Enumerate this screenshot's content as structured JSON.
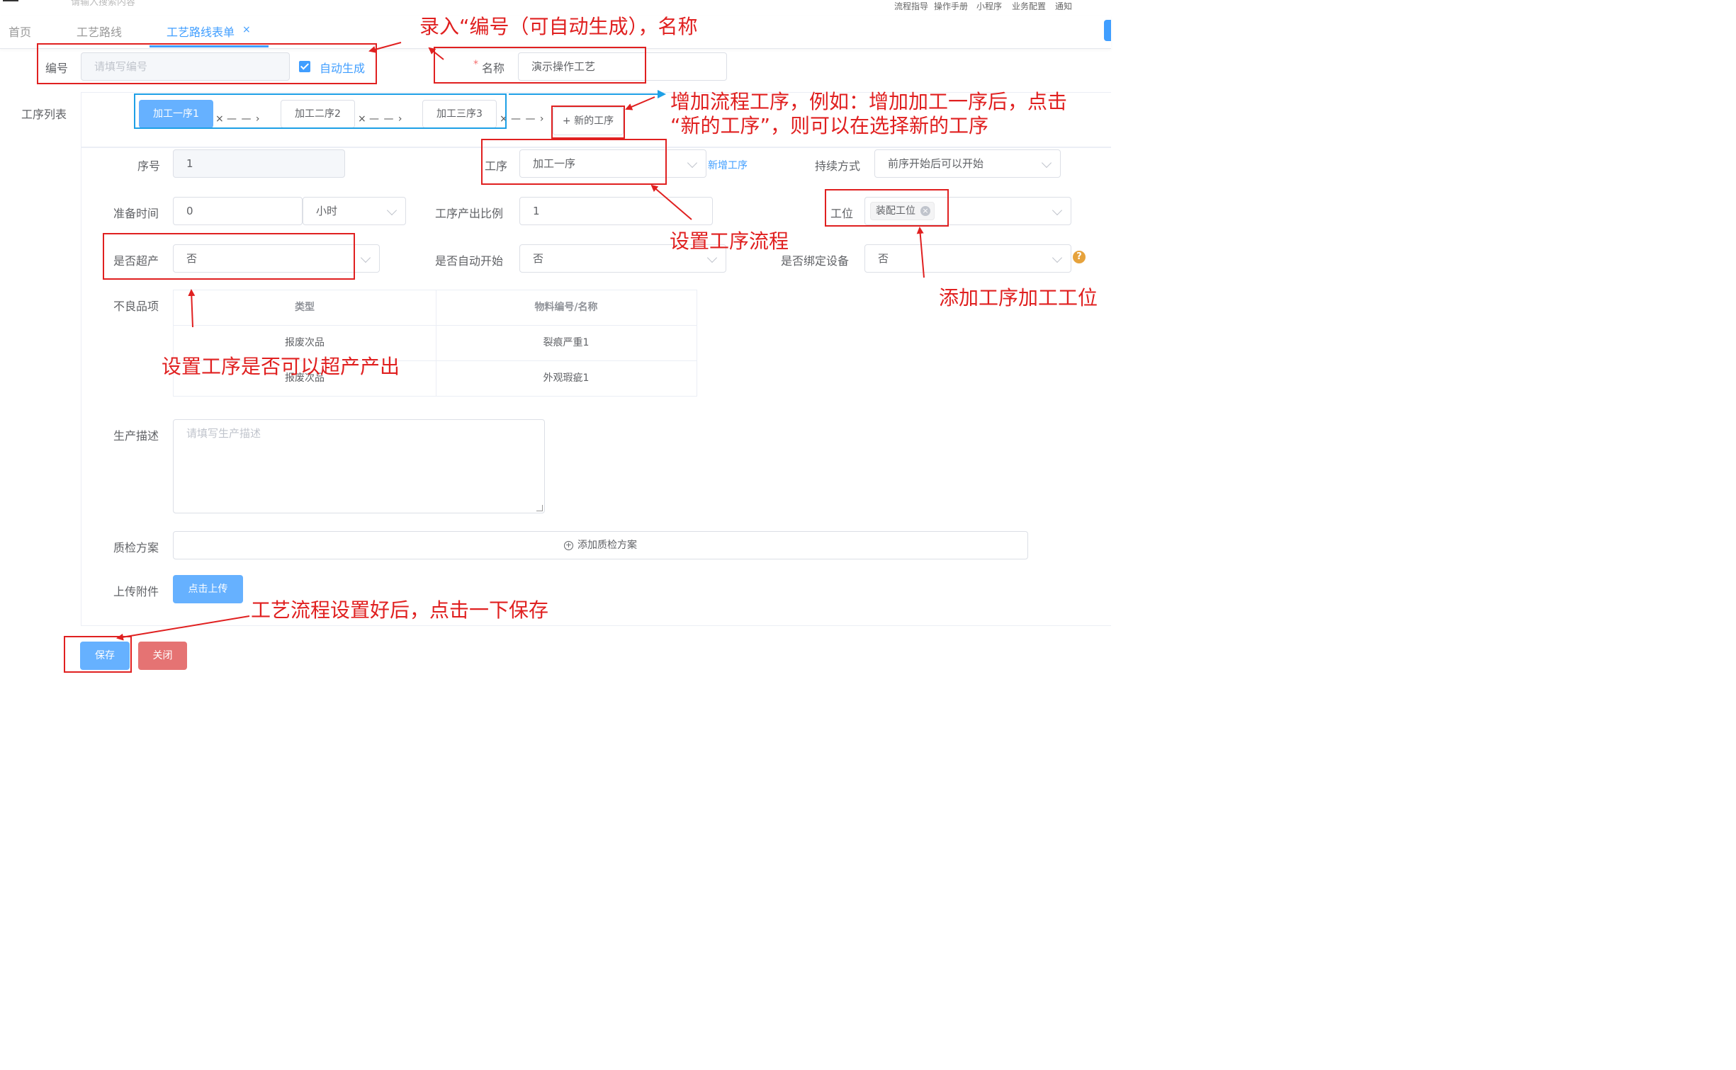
{
  "topbar": {
    "search_placeholder": "请输入搜索内容",
    "menu": [
      "流程指导",
      "操作手册",
      "小程序",
      "业务配置",
      "通知"
    ]
  },
  "tabs": [
    {
      "label": "首页"
    },
    {
      "label": "工艺路线"
    },
    {
      "label": "工艺路线表单",
      "close": "×"
    }
  ],
  "form": {
    "code_label": "编号",
    "code_placeholder": "请填写编号",
    "auto_generate_label": "自动生成",
    "name_required_mark": "*",
    "name_label": "名称",
    "name_value": "演示操作工艺",
    "process_list_label": "工序列表",
    "steps": [
      "加工一序1",
      "加工二序2",
      "加工三序3"
    ],
    "step_close": "×",
    "step_arrow": "— — ›",
    "new_step_button": "+ 新的工序",
    "seq_label": "序号",
    "seq_value": "1",
    "process_label": "工序",
    "process_value": "加工一序",
    "new_process_link": "新增工序",
    "duration_label": "持续方式",
    "duration_value": "前序开始后可以开始",
    "prep_time_label": "准备时间",
    "prep_time_value": "0",
    "prep_time_unit": "小时",
    "output_ratio_label": "工序产出比例",
    "output_ratio_value": "1",
    "station_label": "工位",
    "station_tag": "装配工位",
    "overproduce_label": "是否超产",
    "overproduce_value": "否",
    "auto_start_label": "是否自动开始",
    "auto_start_value": "否",
    "bind_device_label": "是否绑定设备",
    "bind_device_value": "否",
    "help_icon": "?",
    "defect_label": "不良品项",
    "defect_table": {
      "headers": [
        "类型",
        "物料编号/名称"
      ],
      "rows": [
        [
          "报废次品",
          "裂痕严重1"
        ],
        [
          "报废次品",
          "外观瑕疵1"
        ]
      ]
    },
    "description_label": "生产描述",
    "description_placeholder": "请填写生产描述",
    "qc_label": "质检方案",
    "qc_add_button": "添加质检方案",
    "attachment_label": "上传附件",
    "upload_button": "点击上传"
  },
  "footer": {
    "save_button": "保存",
    "close_button": "关闭"
  },
  "annotations": {
    "a1": "录入“编号（可自动生成），名称",
    "a2_line1": "增加流程工序，例如：增加加工一序后，点击",
    "a2_line2": "“新的工序”，则可以在选择新的工序",
    "a3": "设置工序流程",
    "a4": "添加工序加工工位",
    "a5": "设置工序是否可以超产产出",
    "a6": "工艺流程设置好后，点击一下保存"
  },
  "colors": {
    "primary": "#409eff",
    "primary_light": "#66b1ff",
    "danger": "#f56c6c",
    "annotation_red": "#e02020",
    "annotation_blue": "#1ea0e6",
    "warning": "#e6a23c"
  }
}
